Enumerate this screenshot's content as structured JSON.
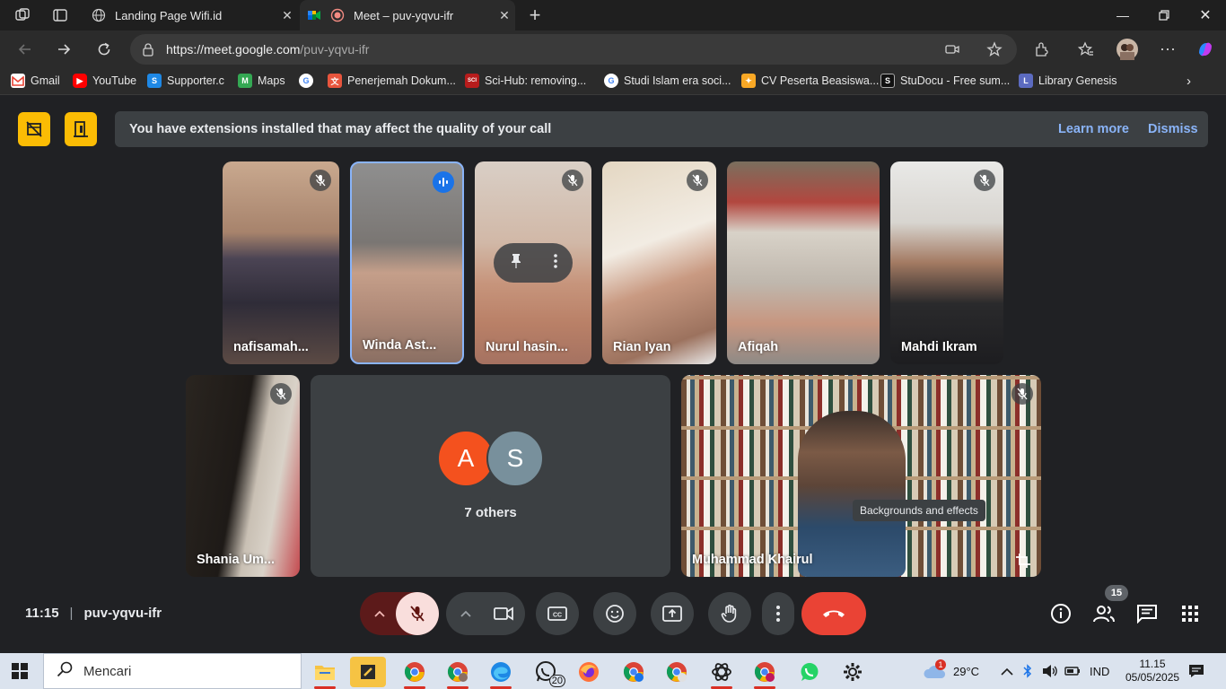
{
  "browser": {
    "tabs": [
      {
        "label": "Landing Page Wifi.id",
        "active": false
      },
      {
        "label": "Meet – puv-yqvu-ifr",
        "active": true
      }
    ],
    "url_domain": "https://meet.google.com",
    "url_path": "/puv-yqvu-ifr",
    "bookmarks": [
      {
        "label": "Gmail",
        "icon": "gmail-icon"
      },
      {
        "label": "YouTube",
        "icon": "youtube-icon"
      },
      {
        "label": "Supporter.c",
        "icon": "supporter-icon"
      },
      {
        "label": "Maps",
        "icon": "maps-icon"
      },
      {
        "label": "",
        "icon": "google-icon"
      },
      {
        "label": "Penerjemah Dokum...",
        "icon": "translate-icon"
      },
      {
        "label": "Sci-Hub: removing...",
        "icon": "scihub-icon"
      },
      {
        "label": "Studi Islam era soci...",
        "icon": "google-icon"
      },
      {
        "label": "CV Peserta Beasiswa...",
        "icon": "cv-icon"
      },
      {
        "label": "StuDocu - Free sum...",
        "icon": "studocu-icon"
      },
      {
        "label": "Library Genesis",
        "icon": "libgen-icon"
      }
    ]
  },
  "banner": {
    "message": "You have extensions installed that may affect the quality of your call",
    "learn_more": "Learn more",
    "dismiss": "Dismiss"
  },
  "participants": {
    "p1": "nafisamah...",
    "p2": "Winda Ast...",
    "p3": "Nurul hasin...",
    "p4": "Rian Iyan",
    "p5": "Afiqah",
    "p6": "Mahdi Ikram",
    "p7": "Shania Um...",
    "p8": "Muhammad Khairul"
  },
  "others": {
    "avatar1": "A",
    "avatar2": "S",
    "label": "7 others",
    "avatar1_color": "#f4511e",
    "avatar2_color": "#78909c"
  },
  "tooltip": "Backgrounds and effects",
  "meeting": {
    "time": "11:15",
    "code": "puv-yqvu-ifr",
    "people_count": "15"
  },
  "taskbar": {
    "search_placeholder": "Mencari",
    "whatsapp_badge": "20",
    "weather_badge": "1",
    "temperature": "29°C",
    "language": "IND",
    "time": "11.15",
    "date": "05/05/2025"
  },
  "colors": {
    "meet_bg": "#202124",
    "surface": "#3c4043",
    "accent_blue": "#8ab4f8",
    "end_call_red": "#ea4335",
    "warning_yellow": "#fbbc04"
  }
}
